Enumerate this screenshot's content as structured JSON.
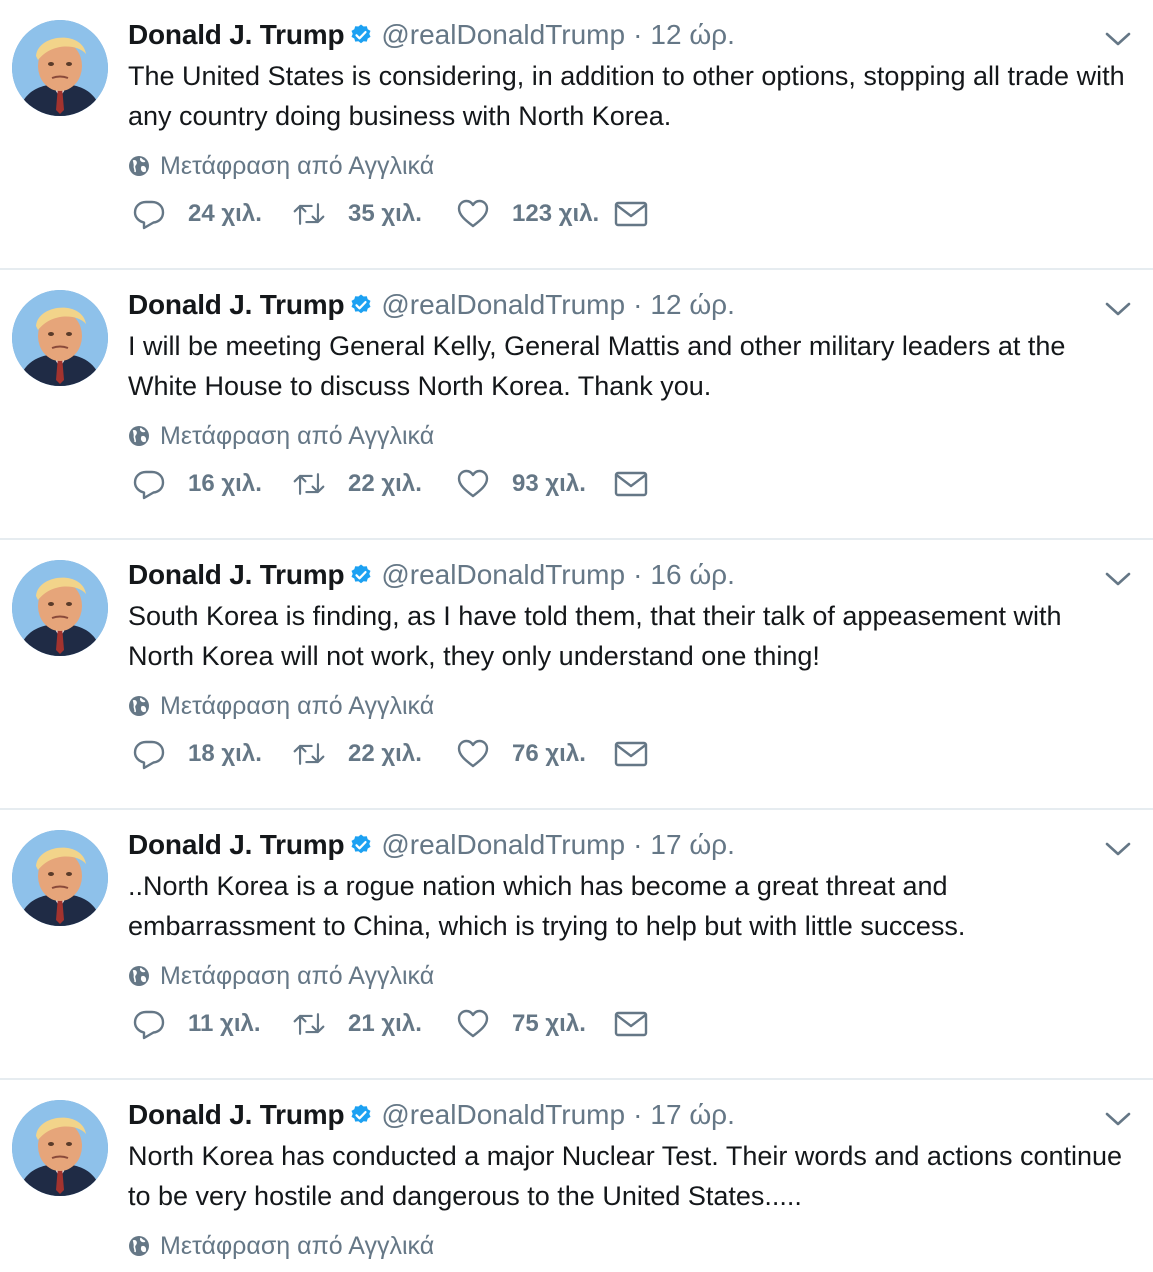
{
  "tweets": [
    {
      "name": "Donald J. Trump",
      "handle": "@realDonaldTrump",
      "separator": "·",
      "time": "12 ώρ.",
      "text": "The United States is considering, in addition to other options, stopping all trade with any country doing business with North Korea.",
      "translate": "Μετάφραση από Αγγλικά",
      "replies": "24 χιλ.",
      "retweets": "35 χιλ.",
      "likes": "123 χιλ."
    },
    {
      "name": "Donald J. Trump",
      "handle": "@realDonaldTrump",
      "separator": "·",
      "time": "12 ώρ.",
      "text": "I will be meeting General Kelly, General Mattis and other military leaders at the White House to discuss North Korea. Thank you.",
      "translate": "Μετάφραση από Αγγλικά",
      "replies": "16 χιλ.",
      "retweets": "22 χιλ.",
      "likes": "93 χιλ."
    },
    {
      "name": "Donald J. Trump",
      "handle": "@realDonaldTrump",
      "separator": "·",
      "time": "16 ώρ.",
      "text": "South Korea is finding, as I have told them, that their talk of appeasement with North Korea will not work, they only understand one thing!",
      "translate": "Μετάφραση από Αγγλικά",
      "replies": "18 χιλ.",
      "retweets": "22 χιλ.",
      "likes": "76 χιλ."
    },
    {
      "name": "Donald J. Trump",
      "handle": "@realDonaldTrump",
      "separator": "·",
      "time": "17 ώρ.",
      "text": "..North Korea is a rogue nation which has become a great threat and embarrassment to China, which is trying to help but with little success.",
      "translate": "Μετάφραση από Αγγλικά",
      "replies": "11 χιλ.",
      "retweets": "21 χιλ.",
      "likes": "75 χιλ."
    },
    {
      "name": "Donald J. Trump",
      "handle": "@realDonaldTrump",
      "separator": "·",
      "time": "17 ώρ.",
      "text": "North Korea has conducted a major Nuclear Test. Their words and actions continue to be very hostile and dangerous to the United States.....",
      "translate": "Μετάφραση από Αγγλικά"
    }
  ],
  "colors": {
    "verified": "#1da1f2",
    "muted": "#657786",
    "text": "#14171a",
    "divider": "#e6ecf0"
  },
  "icons": [
    "verified-badge-icon",
    "chevron-down-icon",
    "globe-icon",
    "reply-icon",
    "retweet-icon",
    "like-icon",
    "direct-message-icon"
  ]
}
